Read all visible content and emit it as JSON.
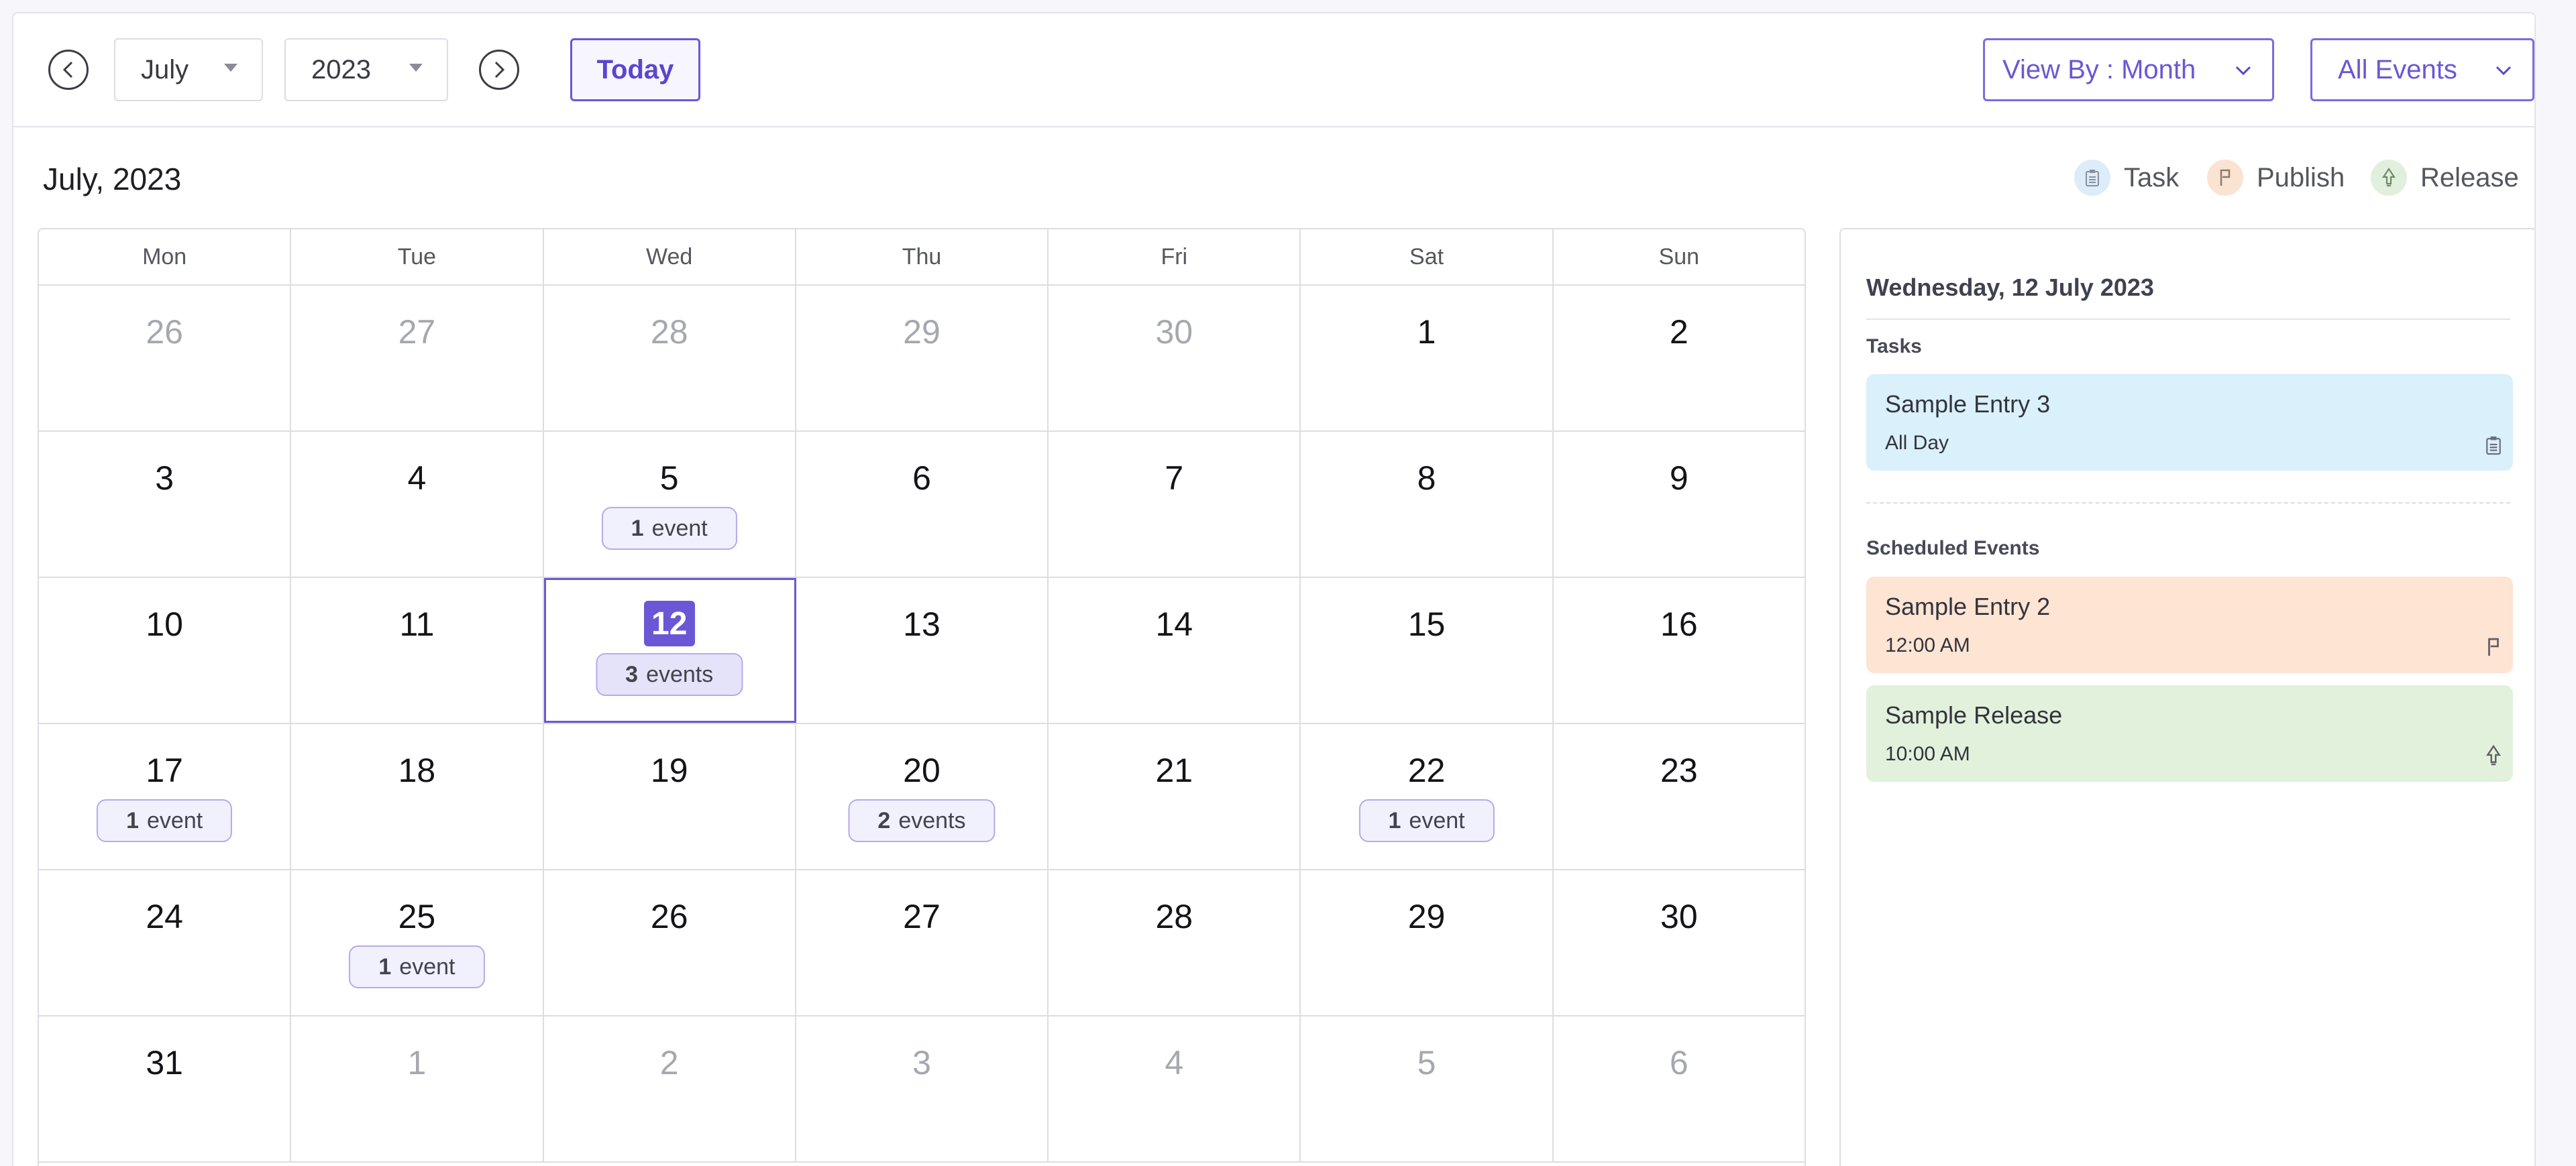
{
  "toolbar": {
    "month": "July",
    "year": "2023",
    "today_label": "Today",
    "view_by": "View By : Month",
    "filter": "All Events"
  },
  "header": {
    "title": "July, 2023",
    "legend": [
      {
        "label": "Task",
        "icon": "clipboard-icon",
        "color": "#dcecf8"
      },
      {
        "label": "Publish",
        "icon": "flag-icon",
        "color": "#fbe3d2"
      },
      {
        "label": "Release",
        "icon": "rocket-icon",
        "color": "#e1f0dc"
      }
    ]
  },
  "calendar": {
    "weekdays": [
      "Mon",
      "Tue",
      "Wed",
      "Thu",
      "Fri",
      "Sat",
      "Sun"
    ],
    "weeks": [
      [
        {
          "d": "26",
          "m": true
        },
        {
          "d": "27",
          "m": true
        },
        {
          "d": "28",
          "m": true
        },
        {
          "d": "29",
          "m": true
        },
        {
          "d": "30",
          "m": true
        },
        {
          "d": "1"
        },
        {
          "d": "2"
        }
      ],
      [
        {
          "d": "3"
        },
        {
          "d": "4"
        },
        {
          "d": "5",
          "n": "1",
          "w": "event"
        },
        {
          "d": "6"
        },
        {
          "d": "7"
        },
        {
          "d": "8"
        },
        {
          "d": "9"
        }
      ],
      [
        {
          "d": "10"
        },
        {
          "d": "11"
        },
        {
          "d": "12",
          "n": "3",
          "w": "events",
          "sel": true
        },
        {
          "d": "13"
        },
        {
          "d": "14"
        },
        {
          "d": "15"
        },
        {
          "d": "16"
        }
      ],
      [
        {
          "d": "17",
          "n": "1",
          "w": "event"
        },
        {
          "d": "18"
        },
        {
          "d": "19"
        },
        {
          "d": "20",
          "n": "2",
          "w": "events"
        },
        {
          "d": "21"
        },
        {
          "d": "22",
          "n": "1",
          "w": "event"
        },
        {
          "d": "23"
        }
      ],
      [
        {
          "d": "24"
        },
        {
          "d": "25",
          "n": "1",
          "w": "event"
        },
        {
          "d": "26"
        },
        {
          "d": "27"
        },
        {
          "d": "28"
        },
        {
          "d": "29"
        },
        {
          "d": "30"
        }
      ],
      [
        {
          "d": "31"
        },
        {
          "d": "1",
          "m": true
        },
        {
          "d": "2",
          "m": true
        },
        {
          "d": "3",
          "m": true
        },
        {
          "d": "4",
          "m": true
        },
        {
          "d": "5",
          "m": true
        },
        {
          "d": "6",
          "m": true
        }
      ]
    ]
  },
  "panel": {
    "date": "Wednesday, 12 July 2023",
    "tasks_label": "Tasks",
    "scheduled_label": "Scheduled Events",
    "tasks": [
      {
        "title": "Sample Entry 3",
        "time": "All Day",
        "color": "#daf0fb",
        "icon": "clipboard-icon"
      }
    ],
    "scheduled": [
      {
        "title": "Sample Entry 2",
        "time": "12:00 AM",
        "color": "#fde4d3",
        "icon": "flag-icon"
      },
      {
        "title": "Sample Release",
        "time": "10:00 AM",
        "color": "#e1f1dc",
        "icon": "rocket-icon"
      }
    ]
  }
}
